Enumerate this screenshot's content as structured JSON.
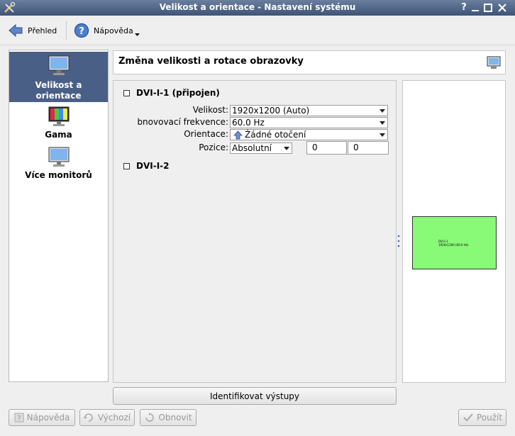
{
  "window": {
    "title": "Velikost a orientace - Nastavení systému",
    "help_glyph": "?"
  },
  "toolbar": {
    "overview_label": "Přehled",
    "help_label": "Nápověda"
  },
  "sidebar": {
    "items": [
      {
        "label": "Velikost a orientace",
        "active": true
      },
      {
        "label": "Gama",
        "active": false
      },
      {
        "label": "Více monitorů",
        "active": false
      }
    ]
  },
  "main": {
    "header": "Změna velikosti a rotace obrazovky",
    "outputs": [
      {
        "name": "DVI-I-1 (připojen)"
      },
      {
        "name": "DVI-I-2"
      }
    ],
    "fields": {
      "size_label": "Velikost:",
      "size_value": "1920x1200 (Auto)",
      "refresh_label": "bnovovací frekvence:",
      "refresh_value": "60.0 Hz",
      "orientation_label": "Orientace:",
      "orientation_value": "Žádné otočení",
      "position_label": "Pozice:",
      "position_value": "Absolutní",
      "pos_x": "0",
      "pos_y": "0"
    },
    "identify_label": "Identifikovat výstupy"
  },
  "preview": {
    "screen_name": "DVI-I-1",
    "screen_mode": "1920x1200 (60.0 Hz)",
    "screen_color": "#88fa77"
  },
  "footer": {
    "help_label": "Nápověda",
    "defaults_label": "Výchozí",
    "reset_label": "Obnovit",
    "apply_label": "Použít"
  },
  "icons": {
    "app": "tools-icon",
    "back": "back-arrow-icon",
    "help": "help-icon",
    "monitor": "monitor-icon",
    "gamma": "gamma-icon",
    "rotate": "rotate-up-icon"
  }
}
